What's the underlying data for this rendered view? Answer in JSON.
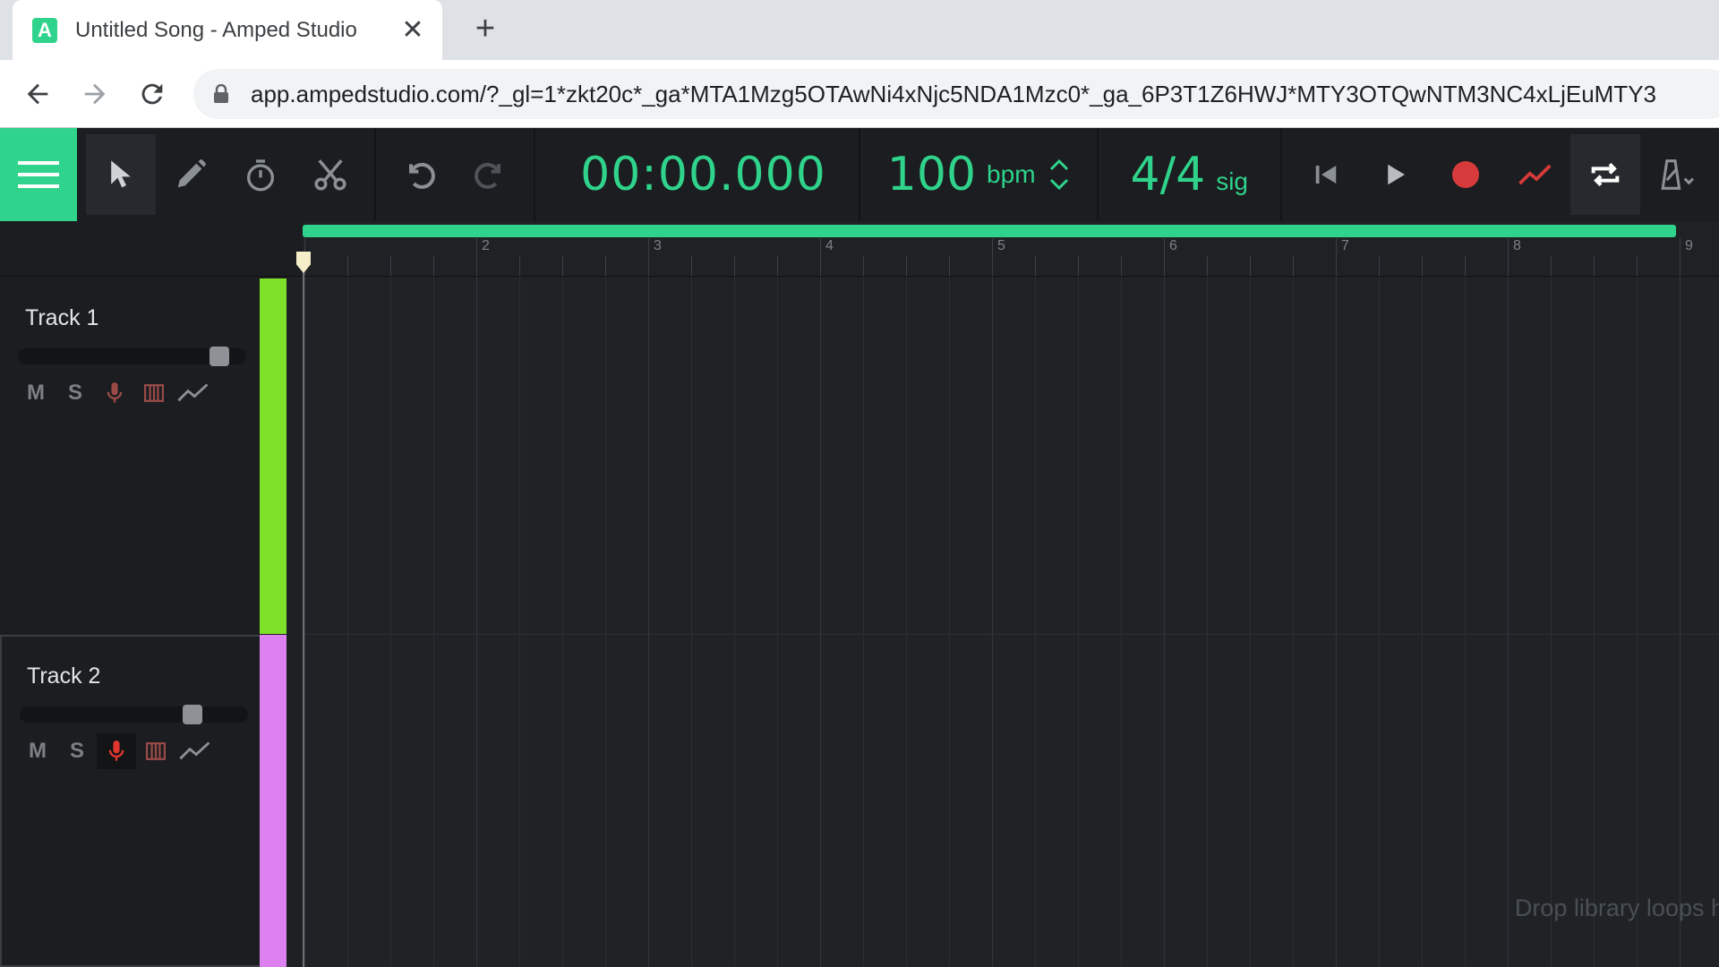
{
  "browser": {
    "tab_title": "Untitled Song - Amped Studio",
    "tab_favicon_letter": "A",
    "tab_close": "✕",
    "new_tab": "+",
    "url": "app.ampedstudio.com/?_gl=1*zkt20c*_ga*MTA1Mzg5OTAwNi4xNjc5NDA1Mzc0*_ga_6P3T1Z6HWJ*MTY3OTQwNTM3NC4xLjEuMTY3"
  },
  "toolbar": {
    "tools": [
      "pointer-icon",
      "pencil-icon",
      "stopwatch-icon",
      "scissors-icon",
      "undo-icon",
      "redo-icon"
    ],
    "time": "00:00.000",
    "bpm_value": "100",
    "bpm_unit": "bpm",
    "signature_value": "4/4",
    "signature_unit": "sig",
    "transport": [
      "skip-to-start-icon",
      "play-icon",
      "record-icon",
      "automation-icon",
      "loop-icon",
      "metronome-icon"
    ]
  },
  "colors": {
    "accent": "#2fd38b",
    "record": "#d63a3a",
    "track1": "#80e12a",
    "track2": "#dd80f0"
  },
  "ruler": {
    "bars": [
      "2",
      "3",
      "4",
      "5",
      "6",
      "7",
      "8",
      "9"
    ]
  },
  "tracks": [
    {
      "name": "Track 1",
      "mute": "M",
      "solo": "S",
      "armed": false,
      "volume": 0.92
    },
    {
      "name": "Track 2",
      "mute": "M",
      "solo": "S",
      "armed": true,
      "volume": 0.78
    }
  ],
  "drop_hint": "Drop library loops h"
}
